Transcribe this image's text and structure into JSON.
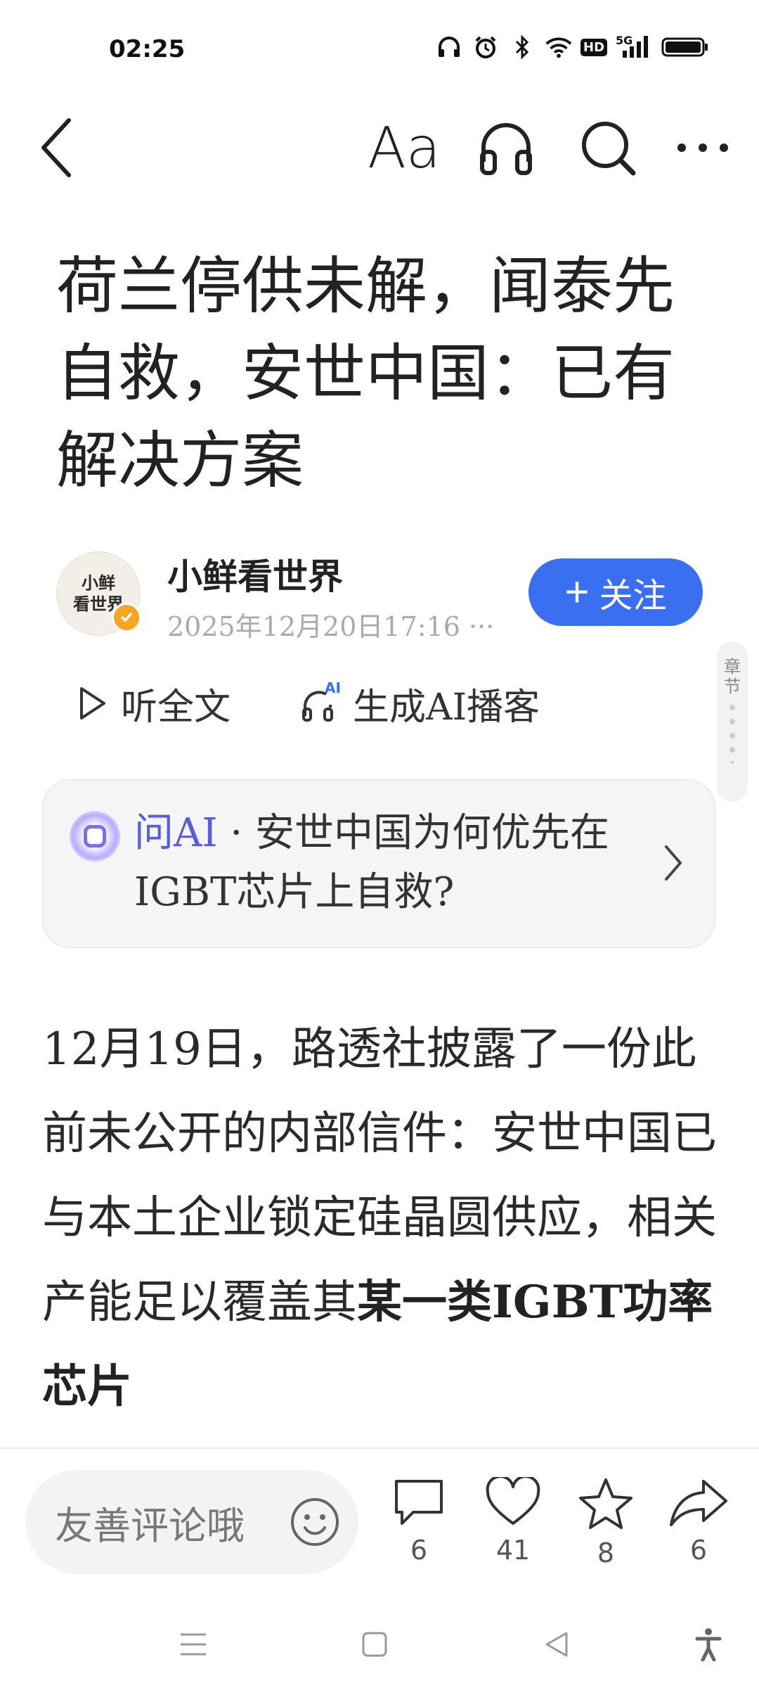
{
  "status_bar": {
    "time": "02:25",
    "icons": [
      "headphones-icon",
      "alarm-icon",
      "bluetooth-icon",
      "wifi-icon",
      "hd-icon",
      "signal-5g-icon",
      "battery-icon"
    ],
    "hd_label": "HD",
    "network_label": "5G"
  },
  "nav": {
    "font_label": "Aa"
  },
  "article": {
    "title": "荷兰停供未解，闻泰先自救，安世中国：已有解决方案",
    "body_normal": "12月19日，路透社披露了一份此前未公开的内部信件：安世中国已与本土企业锁定硅晶圆供应，相关产能足以覆盖其",
    "body_bold": "某一类IGBT功率芯片"
  },
  "author": {
    "avatar_text_line1": "小鲜",
    "avatar_text_line2": "看世界",
    "name": "小鲜看世界",
    "meta": "2025年12月20日17:16 ···",
    "follow_label": "关注",
    "follow_prefix": "+"
  },
  "listen": {
    "listen_label": "听全文",
    "podcast_label": "生成AI播客",
    "podcast_badge": "AI"
  },
  "chapter_tab": {
    "label_line1": "章",
    "label_line2": "节"
  },
  "ai_card": {
    "brand": "问AI",
    "separator": " · ",
    "question": "安世中国为何优先在IGBT芯片上自救?"
  },
  "bottom_bar": {
    "comment_placeholder": "友善评论哦",
    "comment_count": "6",
    "like_count": "41",
    "favorite_count": "8",
    "share_count": "6"
  },
  "colors": {
    "accent": "#3a6ff2",
    "ai_brand": "#5a5ce0",
    "verified": "#f5a623"
  }
}
